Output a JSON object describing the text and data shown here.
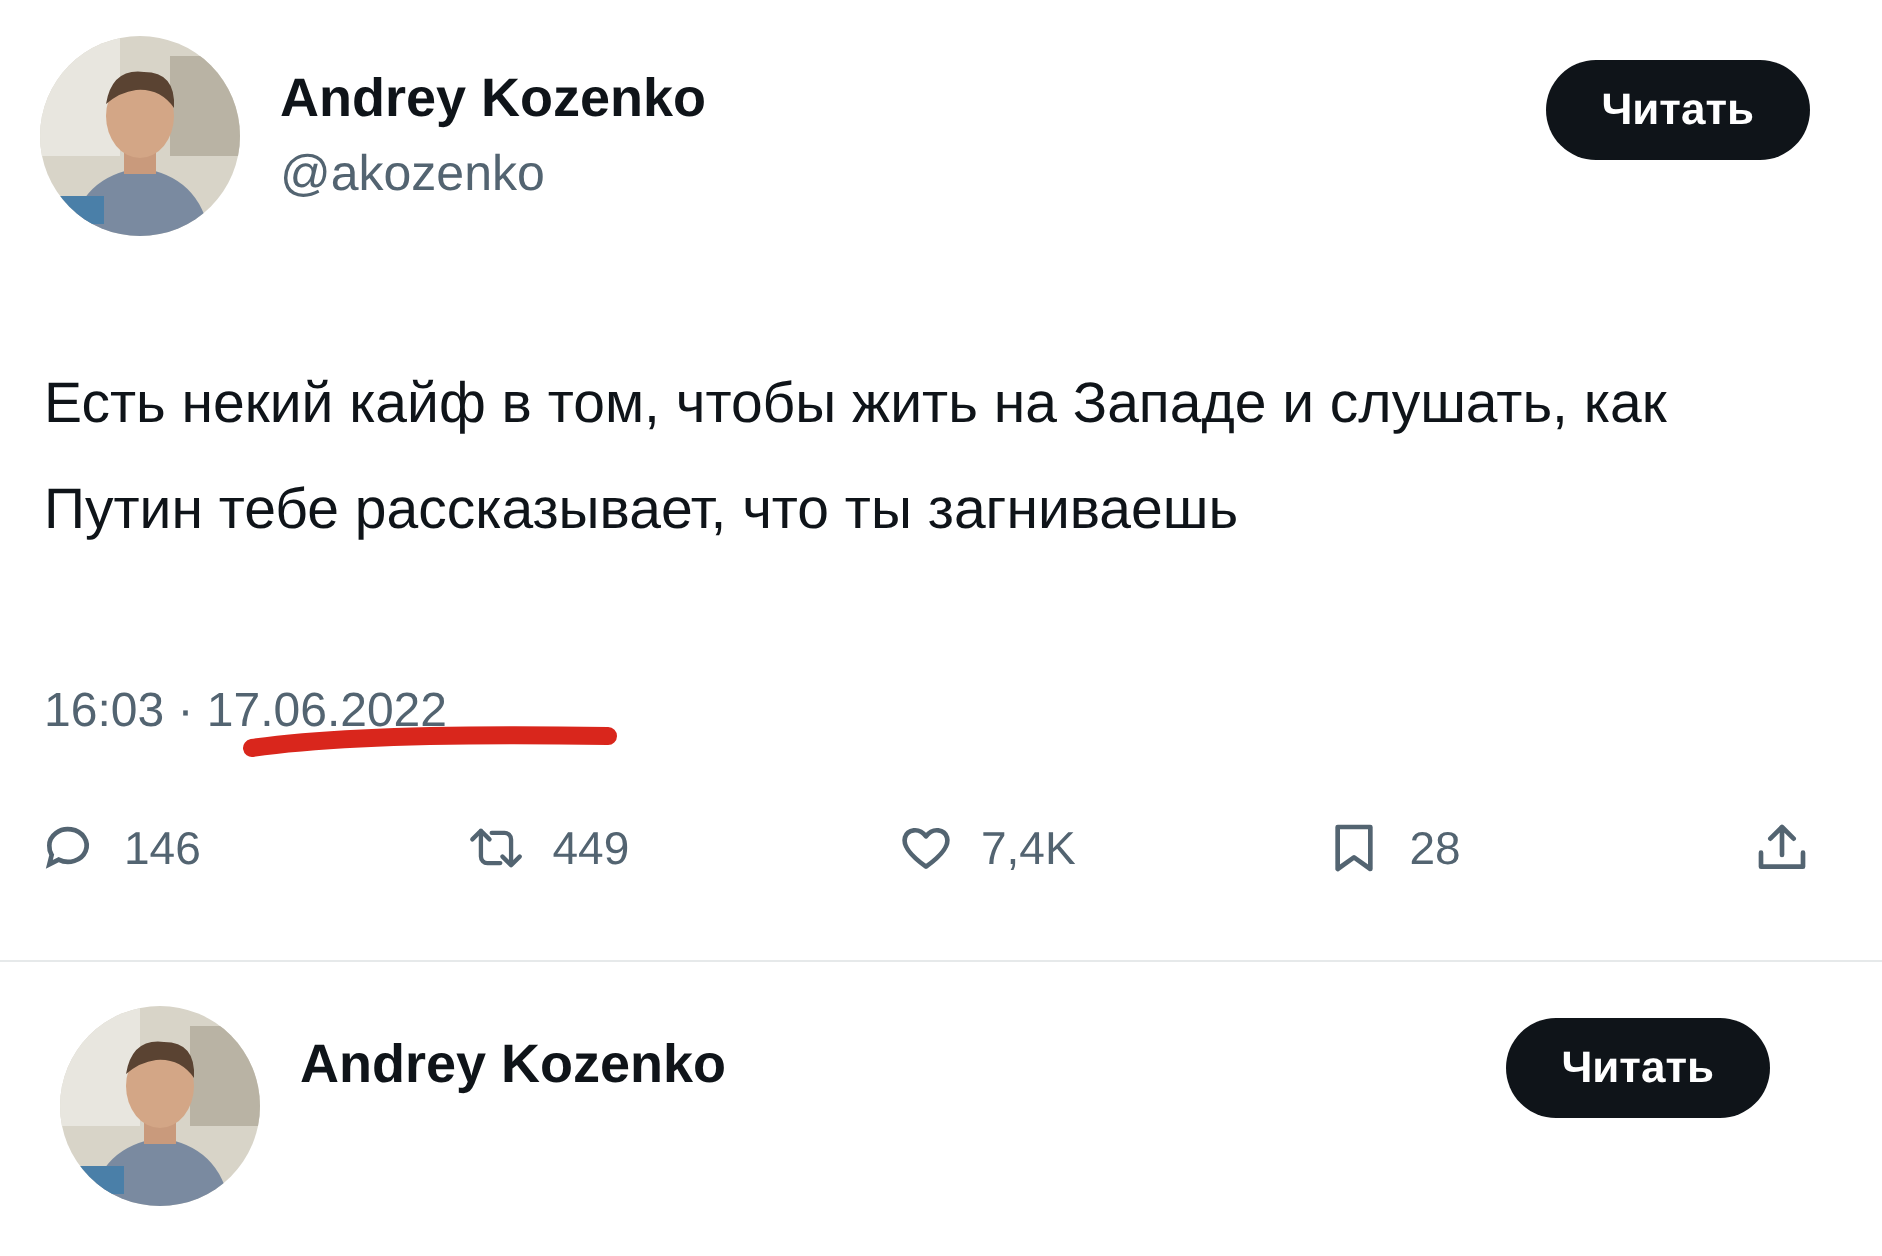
{
  "tweet": {
    "author": "Andrey Kozenko",
    "handle": "@akozenko",
    "button": "Читать",
    "text": "Есть некий кайф в том, чтобы жить на Западе и слушать, как Путин тебе рассказывает, что ты загниваешь",
    "time": "16:03 · 17.06.2022",
    "actions": [
      {
        "kind": "reply",
        "count": "146"
      },
      {
        "kind": "retweet",
        "count": "449"
      },
      {
        "kind": "like",
        "count": "7,4K"
      },
      {
        "kind": "bookmark",
        "count": "28"
      },
      {
        "kind": "share"
      }
    ]
  },
  "next_tweet": {
    "author": "Andrey Kozenko",
    "button": "Читать"
  }
}
